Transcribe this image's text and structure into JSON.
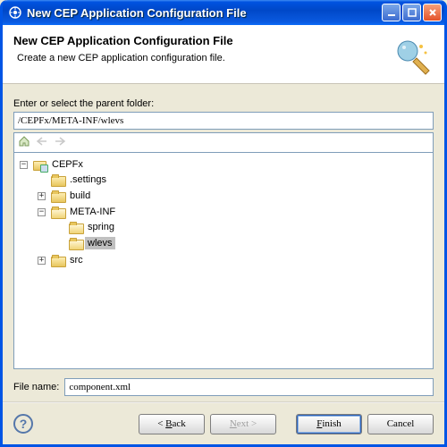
{
  "window": {
    "title": "New CEP Application Configuration File"
  },
  "banner": {
    "title": "New CEP Application Configuration File",
    "subtitle": "Create a new CEP application configuration file."
  },
  "body": {
    "parentLabel": "Enter or select the parent folder:",
    "parentPath": "/CEPFx/META-INF/wlevs",
    "fileNameLabel": "File name:",
    "fileName": "component.xml"
  },
  "tree": {
    "root": {
      "label": "CEPFx",
      "children": [
        {
          "label": ".settings"
        },
        {
          "label": "build",
          "hasChildren": true
        },
        {
          "label": "META-INF",
          "expanded": true,
          "children": [
            {
              "label": "spring"
            },
            {
              "label": "wlevs",
              "selected": true
            }
          ]
        },
        {
          "label": "src",
          "hasChildren": true
        }
      ]
    }
  },
  "buttons": {
    "back": "< Back",
    "next": "Next >",
    "finish": "Finish",
    "cancel": "Cancel"
  }
}
